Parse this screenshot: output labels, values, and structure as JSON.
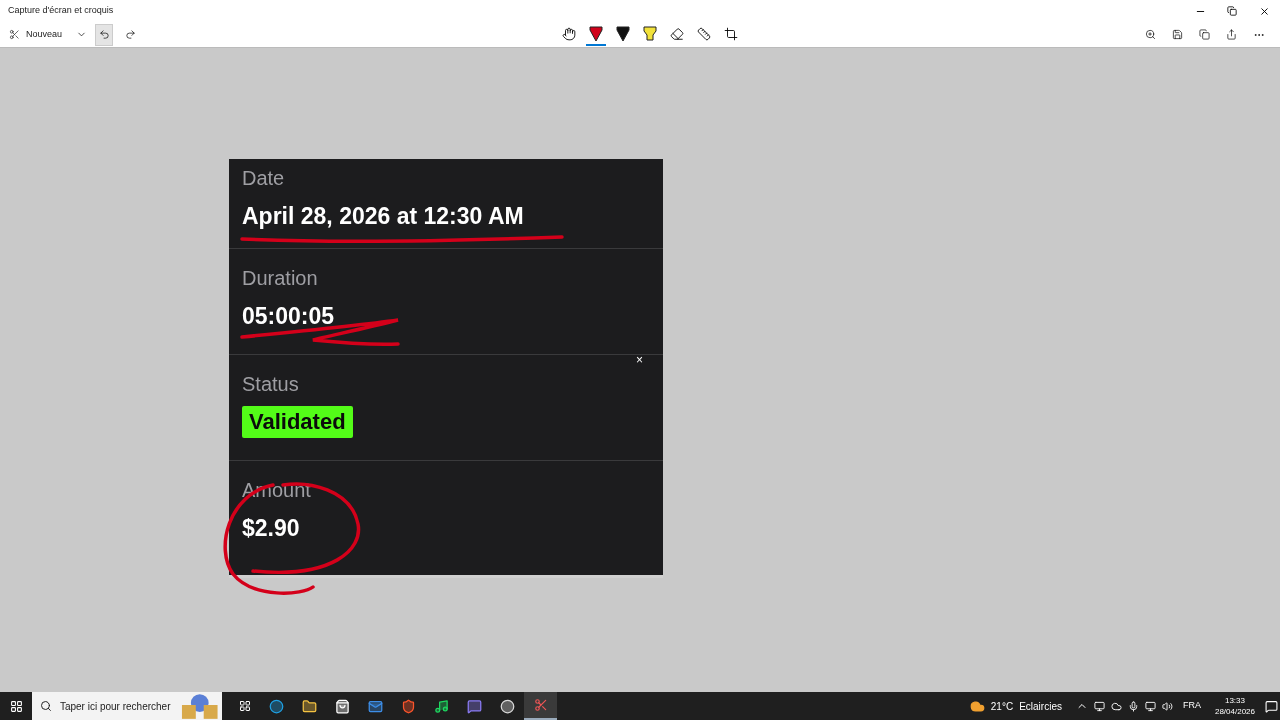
{
  "window": {
    "title": "Capture d'écran et croquis"
  },
  "toolbar": {
    "new_label": "Nouveau",
    "tools": [
      {
        "kind": "touch",
        "selected": false
      },
      {
        "kind": "pen",
        "color": "#d0021b",
        "selected": true
      },
      {
        "kind": "pen",
        "color": "#111111",
        "selected": false
      },
      {
        "kind": "highlighter",
        "color": "#f2e23a",
        "selected": false
      },
      {
        "kind": "eraser",
        "selected": false
      },
      {
        "kind": "ruler",
        "selected": false
      },
      {
        "kind": "crop",
        "selected": false
      }
    ]
  },
  "screenshot": {
    "fields": [
      {
        "label": "Date",
        "value": "April 28, 2026 at 12:30 AM",
        "kind": "text"
      },
      {
        "label": "Duration",
        "value": "05:00:05",
        "kind": "text"
      },
      {
        "label": "Status",
        "value": "Validated",
        "kind": "badge"
      },
      {
        "label": "Amount",
        "value": "$2.90",
        "kind": "text"
      }
    ],
    "close_mark": "×"
  },
  "taskbar": {
    "search_placeholder": "Taper ici pour rechercher",
    "weather": {
      "temperature": "21°C",
      "condition": "Eclaircies"
    },
    "language": "FRA",
    "time": "13:33",
    "date": "28/04/2026"
  }
}
